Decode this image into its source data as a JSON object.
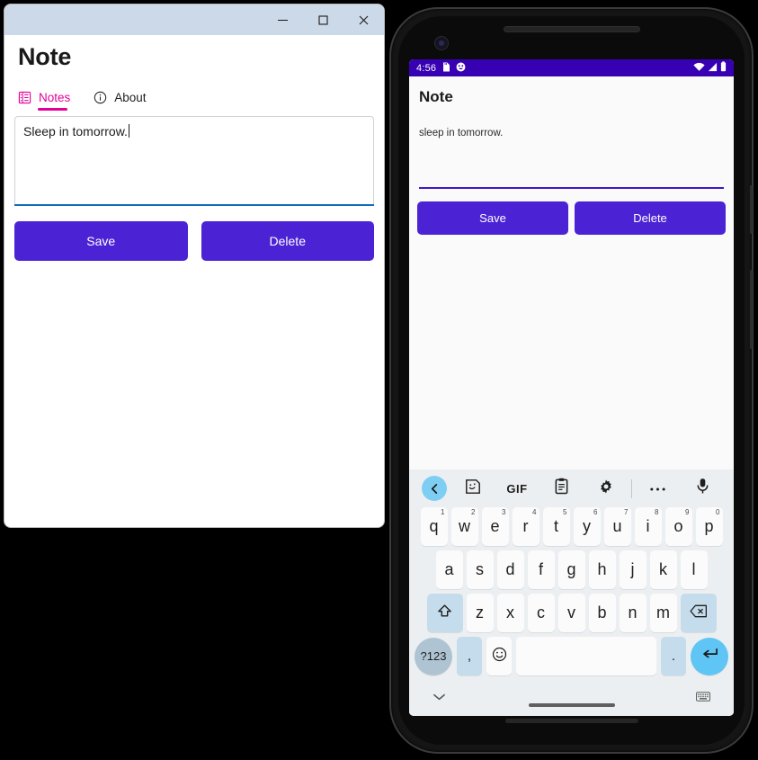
{
  "desktop": {
    "window_controls": {
      "minimize": "minimize-icon",
      "maximize": "maximize-icon",
      "close": "close-icon"
    },
    "title": "Note",
    "tabs": [
      {
        "label": "Notes",
        "icon": "list-icon",
        "selected": true
      },
      {
        "label": "About",
        "icon": "info-icon",
        "selected": false
      }
    ],
    "note_text": "Sleep in tomorrow.",
    "buttons": {
      "save": "Save",
      "delete": "Delete"
    },
    "colors": {
      "titlebar": "#ccd9e8",
      "accent_tab": "#e4009a",
      "focus_underline": "#0f6cbd",
      "button_purple": "#4c23d4"
    }
  },
  "phone": {
    "status_bar": {
      "time": "4:56",
      "left_icons": [
        "sd-card-icon",
        "face-icon"
      ],
      "right_icons": [
        "wifi-icon",
        "signal-icon",
        "battery-icon"
      ],
      "background": "#3700b3"
    },
    "app": {
      "title": "Note",
      "note_text": "sleep in tomorrow.",
      "buttons": {
        "save": "Save",
        "delete": "Delete"
      }
    },
    "keyboard": {
      "toolbar": [
        "back-chevron-icon",
        "sticker-icon",
        "gif-icon",
        "clipboard-icon",
        "gear-icon",
        "more-icon",
        "microphone-icon"
      ],
      "gif_label": "GIF",
      "row1": [
        {
          "letter": "q",
          "num": "1"
        },
        {
          "letter": "w",
          "num": "2"
        },
        {
          "letter": "e",
          "num": "3"
        },
        {
          "letter": "r",
          "num": "4"
        },
        {
          "letter": "t",
          "num": "5"
        },
        {
          "letter": "y",
          "num": "6"
        },
        {
          "letter": "u",
          "num": "7"
        },
        {
          "letter": "i",
          "num": "8"
        },
        {
          "letter": "o",
          "num": "9"
        },
        {
          "letter": "p",
          "num": "0"
        }
      ],
      "row2": [
        "a",
        "s",
        "d",
        "f",
        "g",
        "h",
        "j",
        "k",
        "l"
      ],
      "row3": [
        "z",
        "x",
        "c",
        "v",
        "b",
        "n",
        "m"
      ],
      "shift_key": "shift-icon",
      "backspace_key": "backspace-icon",
      "symbols_key": "?123",
      "comma_key": ",",
      "emoji_key": "emoji-icon",
      "space_key": "",
      "period_key": ".",
      "enter_key": "enter-icon",
      "navbar": {
        "hide_keyboard": "chevron-down-icon",
        "switch_keyboard": "keyboard-icon"
      }
    }
  }
}
